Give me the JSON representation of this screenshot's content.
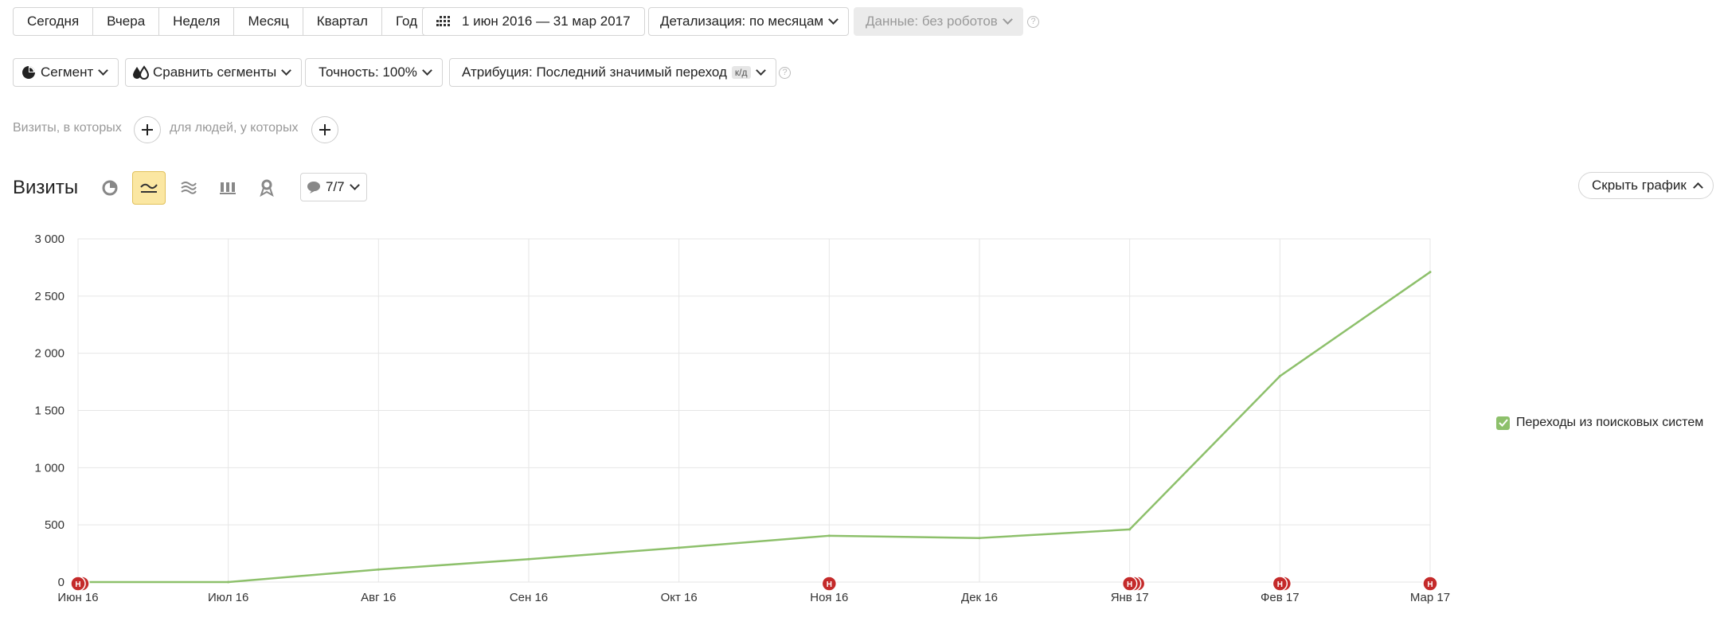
{
  "period_buttons": [
    "Сегодня",
    "Вчера",
    "Неделя",
    "Месяц",
    "Квартал",
    "Год"
  ],
  "date_range": "1 июн 2016 — 31 мар 2017",
  "detail": "Детализация: по месяцам",
  "data_filter": "Данные: без роботов",
  "segment": "Сегмент",
  "compare": "Сравнить сегменты",
  "accuracy": "Точность: 100%",
  "attribution": "Атрибуция: Последний значимый переход",
  "attribution_badge": "к/д",
  "filter_visits": "Визиты, в которых",
  "filter_people": "для людей, у которых",
  "section_title": "Визиты",
  "notes_label": "7/7",
  "hide_chart": "Скрыть график",
  "chart_data": {
    "type": "line",
    "categories": [
      "Июн 16",
      "Июл 16",
      "Авг 16",
      "Сен 16",
      "Окт 16",
      "Ноя 16",
      "Дек 16",
      "Янв 17",
      "Фев 17",
      "Мар 17"
    ],
    "series": [
      {
        "name": "Переходы из поисковых систем",
        "color": "#8dc06b",
        "values": [
          0,
          0,
          110,
          200,
          300,
          405,
          385,
          460,
          1800,
          2710
        ]
      }
    ],
    "yticks": [
      "3 000",
      "2 500",
      "2 000",
      "1 500",
      "1 000",
      "500",
      "0"
    ],
    "ylim": [
      0,
      3000
    ],
    "annotations": [
      {
        "index": 0,
        "label": "Н",
        "count": 2
      },
      {
        "index": 5,
        "label": "Н",
        "count": 1
      },
      {
        "index": 7,
        "label": "Н",
        "count": 3
      },
      {
        "index": 8,
        "label": "Н",
        "count": 2
      },
      {
        "index": 9,
        "label": "Н",
        "count": 1
      }
    ],
    "grid": true,
    "legend": "right"
  }
}
